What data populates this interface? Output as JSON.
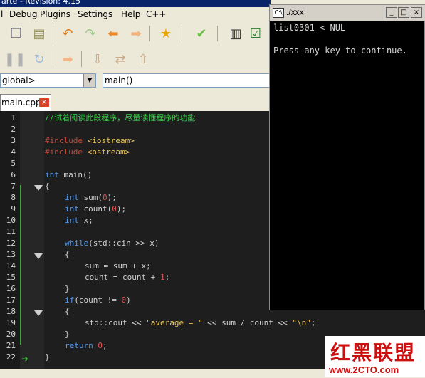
{
  "window": {
    "title": "arte - Revision: 4.15"
  },
  "menu": [
    "Debug",
    "Plugins",
    "Settings",
    "Help",
    "C++"
  ],
  "toolbar1": [
    {
      "icon": "copy-icon"
    },
    {
      "icon": "paste-icon"
    },
    {
      "icon": "undo-icon"
    },
    {
      "icon": "redo-icon"
    },
    {
      "icon": "back-icon"
    },
    {
      "icon": "forward-icon"
    },
    {
      "icon": "bookmark-star-icon"
    },
    {
      "icon": "check-icon"
    },
    {
      "icon": "compile-icon"
    },
    {
      "icon": "build-icon"
    }
  ],
  "toolbar2": [
    {
      "icon": "pause-icon"
    },
    {
      "icon": "restart-icon"
    },
    {
      "icon": "run-arrow-icon"
    },
    {
      "icon": "step-into-icon"
    },
    {
      "icon": "step-over-icon"
    },
    {
      "icon": "step-out-icon"
    }
  ],
  "scope": {
    "value": "global>"
  },
  "function": {
    "value": "main()"
  },
  "tab": {
    "label": "main.cpp",
    "close": "×"
  },
  "code_lines": [
    "1",
    "2",
    "3",
    "4",
    "5",
    "6",
    "7",
    "8",
    "9",
    "10",
    "11",
    "12",
    "13",
    "14",
    "15",
    "16",
    "17",
    "18",
    "19",
    "20",
    "21",
    "22"
  ],
  "code": {
    "l1": "//试着阅读此段程序，尽量读懂程序的功能",
    "l3a": "#include ",
    "l3b": "<iostream>",
    "l4a": "#include ",
    "l4b": "<ostream>",
    "l6a": "int",
    "l6b": " main()",
    "l7": "{",
    "l8a": "int",
    "l8b": " sum(",
    "l8c": "0",
    "l8d": ");",
    "l9a": "int",
    "l9b": " count(",
    "l9c": "0",
    "l9d": ");",
    "l10a": "int",
    "l10b": " x;",
    "l12a": "while",
    "l12b": "(std::cin >> x)",
    "l13": "{",
    "l14a": "sum = sum + x;",
    "l15a": "count = count + ",
    "l15b": "1",
    "l15c": ";",
    "l16": "}",
    "l17a": "if",
    "l17b": "(count != ",
    "l17c": "0",
    "l17d": ")",
    "l18": "{",
    "l19a": "std::cout << ",
    "l19b": "\"average = \"",
    "l19c": " << sum / count << ",
    "l19d": "\"\\n\"",
    "l19e": ";",
    "l20": "}",
    "l21a": "return",
    "l21b": " 0",
    "l21c": ";",
    "l22": "}"
  },
  "console": {
    "title": "./xxx",
    "line1": "list0301 < NUL",
    "line2": "Press any key to continue."
  },
  "watermark": {
    "cn": "红黑联盟",
    "url": "www.2CTO.com"
  },
  "colors": {
    "keyword": "#4f9cf5",
    "comment": "#38d04a",
    "preprocessor": "#c24b3b",
    "string": "#e8c45c",
    "number": "#e05656"
  }
}
